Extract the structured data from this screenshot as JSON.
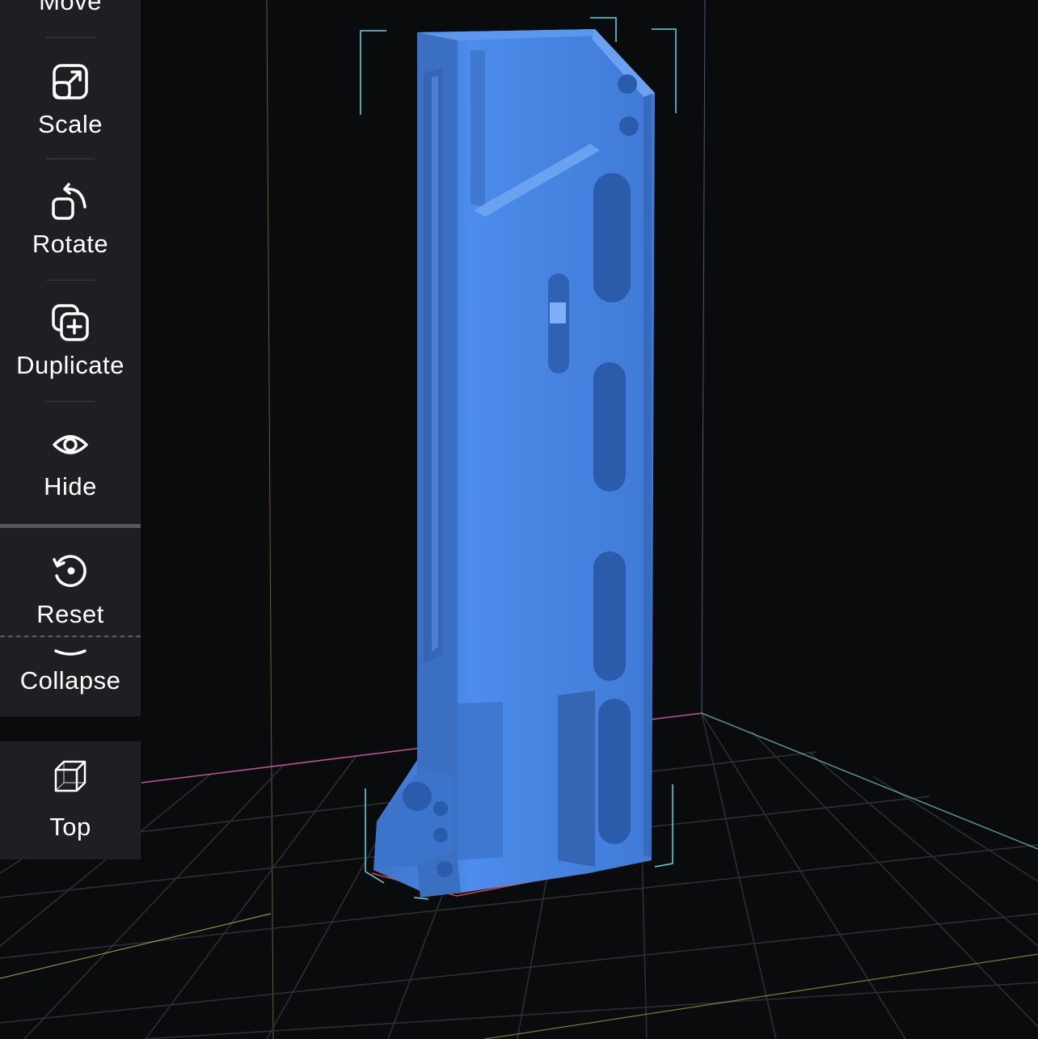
{
  "toolbar": {
    "move_label": "Move",
    "scale_label": "Scale",
    "rotate_label": "Rotate",
    "duplicate_label": "Duplicate",
    "hide_label": "Hide",
    "reset_label": "Reset",
    "collapse_label": "Collapse"
  },
  "view": {
    "top_label": "Top"
  },
  "colors": {
    "model": "#4a8ae8",
    "grid": "#2e3038",
    "panel": "#1e1f23",
    "background": "#0a0b0d"
  }
}
